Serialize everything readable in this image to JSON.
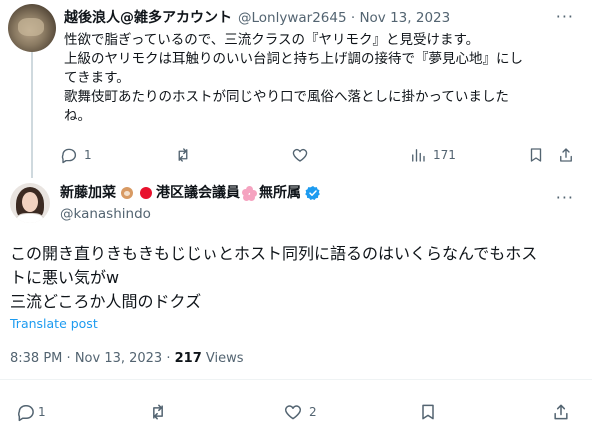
{
  "reply": {
    "author_name": "越後浪人@雑多アカウント",
    "handle": "@Lonlywar2645",
    "separator": "·",
    "date": "Nov 13, 2023",
    "more": "···",
    "text_lines": [
      "性欲で脂ぎっているので、三流クラスの『ヤリモク』と見受けます。",
      "上級のヤリモクは耳触りのいい台詞と持ち上げ調の接待で『夢見心地』にし",
      "てきます。",
      "歌舞伎町あたりのホストが同じやり口で風俗へ落としに掛かっていました",
      "ね。"
    ],
    "actions": {
      "reply_count": "1",
      "retweet_count": "",
      "like_count": "",
      "views_count": "171"
    }
  },
  "main": {
    "name_part1": "新藤加菜",
    "name_part2": "港区議会議員",
    "name_part3": "無所属",
    "handle": "@kanashindo",
    "more": "···",
    "text_lines": [
      "この開き直りきもきもじじぃとホスト同列に語るのはいくらなんでもホス",
      "トに悪い気がw",
      "三流どころか人間のドクズ"
    ],
    "translate": "Translate post",
    "time": "8:38 PM",
    "separator": "·",
    "date": "Nov 13, 2023",
    "views_count": "217",
    "views_label": "Views",
    "actions": {
      "reply_count": "1",
      "retweet_count": "",
      "like_count": "2"
    }
  },
  "colors": {
    "text": "#0f1419",
    "secondary": "#536471",
    "link": "#1d9bf0",
    "verified": "#1d9bf0"
  }
}
